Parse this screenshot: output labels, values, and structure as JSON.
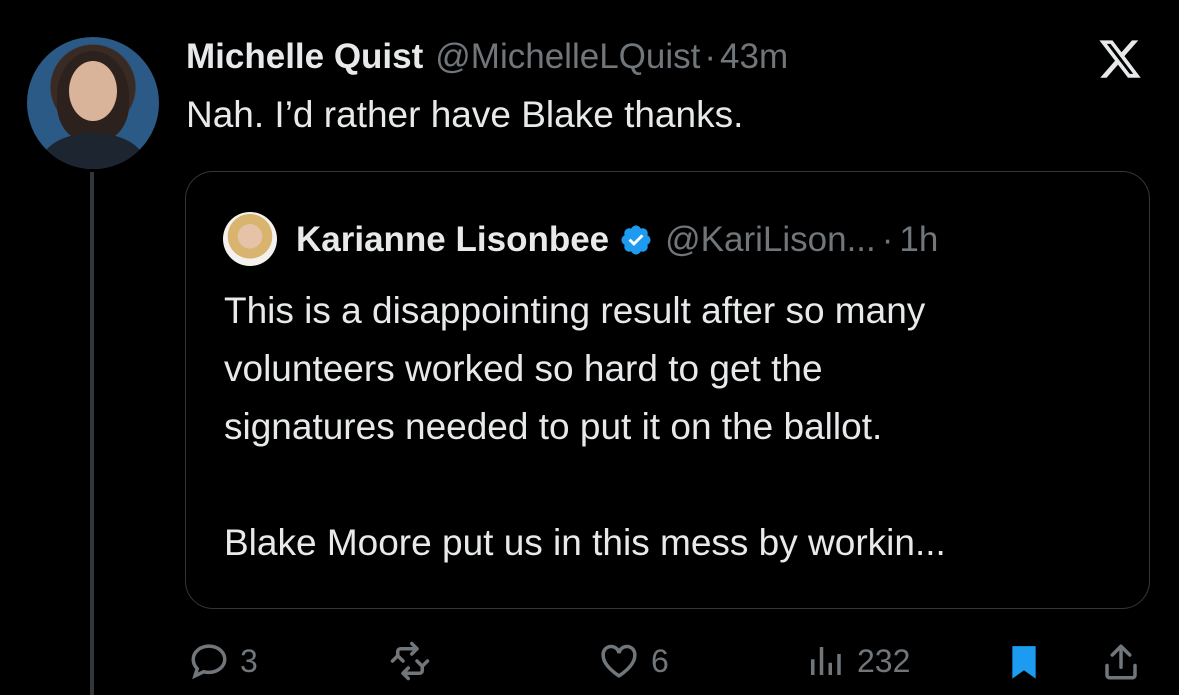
{
  "tweet": {
    "author_name": "Michelle Quist",
    "handle": "@MichelleLQuist",
    "separator": "·",
    "time": "43m",
    "text": "Nah. I’d rather have Blake thanks."
  },
  "quoted_tweet": {
    "author_name": "Karianne Lisonbee",
    "handle": "@KariLison...",
    "separator": "·",
    "time": "1h",
    "lines": [
      "This is a disappointing result after so many",
      "volunteers worked so hard to get the",
      "signatures needed to put it on the ballot.",
      "",
      "Blake Moore put us in this mess by workin..."
    ]
  },
  "actions": {
    "replies": "3",
    "likes": "6",
    "views": "232"
  },
  "colors": {
    "background": "#000000",
    "text": "#e7e9ea",
    "muted": "#71767b",
    "accent": "#1d9bf0",
    "border": "#333639"
  },
  "icons": [
    "x-logo-icon",
    "verified-badge-icon",
    "reply-icon",
    "retweet-icon",
    "like-icon",
    "views-icon",
    "bookmark-icon",
    "share-icon"
  ]
}
